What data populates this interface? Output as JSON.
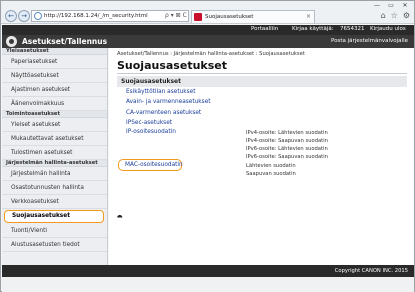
{
  "browser": {
    "address": "http://192.168.1.24/_/m_security.html",
    "tab_title": "Suojausasetukset",
    "addr_tools": "ρ ▾ ⊠ C",
    "back_glyph": "←",
    "forward_glyph": "→",
    "min_glyph": "—",
    "max_glyph": "▭",
    "close_glyph": "✕",
    "tab_close_glyph": "×",
    "home_glyph": "⌂",
    "star_glyph": "☆",
    "gear_glyph": "⚙"
  },
  "header": {
    "links": [
      "Portaalliin",
      "Kirjaa käyttäjä:",
      "7654321",
      "Kirjaudu ulos"
    ],
    "app_title": "Asetukset/Tallennus",
    "right_note": "Posta järjestelmänvalvojalle"
  },
  "sidebar": {
    "sections": [
      {
        "title": "Yleisasetukset",
        "items": [
          "Paperiasetukset",
          "Näyttöasetukset",
          "Ajastimen asetukset",
          "Äänenvoimakkuus"
        ]
      },
      {
        "title": "Toimintoasetukset",
        "items": [
          "Yleiset asetukset",
          "Mukautettavat asetukset",
          "Tulostimen asetukset"
        ]
      },
      {
        "title": "Järjestelmän hallinta-asetukset",
        "items": [
          "Järjestelmän hallinta",
          "Osastotunnusten hallinta",
          "Verkkoasetukset",
          "Suojausasetukset",
          "Tuonti/Vienti",
          "Alustusasetusten tiedot"
        ]
      }
    ],
    "active_item": "Suojausasetukset"
  },
  "main": {
    "breadcrumb": "Asetukset/Tallennus : Järjestelmän hallinta-asetukset : Suojausasetukset",
    "title": "Suojausasetukset",
    "panel_title": "Suojausasetukset",
    "links": [
      "Esikäyttötilan asetukset",
      "Avain- ja varmenneasetukset",
      "CA-varmenteen asetukset",
      "IPSec-asetukset",
      "IP-osoitesuodatin",
      "MAC-osoitesuodatin"
    ],
    "ip_notes": [
      "IPv4-osoite: Lähtevien suodatin",
      "IPv4-osoite: Saapuvan suodatin",
      "IPv6-osoite: Lähtevien suodatin",
      "IPv6-osoite: Saapuvan suodatin"
    ],
    "mac_notes": [
      "Lähtevien suodatin",
      "Saapuvan suodatin"
    ],
    "to_top": "⯊"
  },
  "footer": {
    "copyright": "Copyright CANON INC. 2015"
  }
}
